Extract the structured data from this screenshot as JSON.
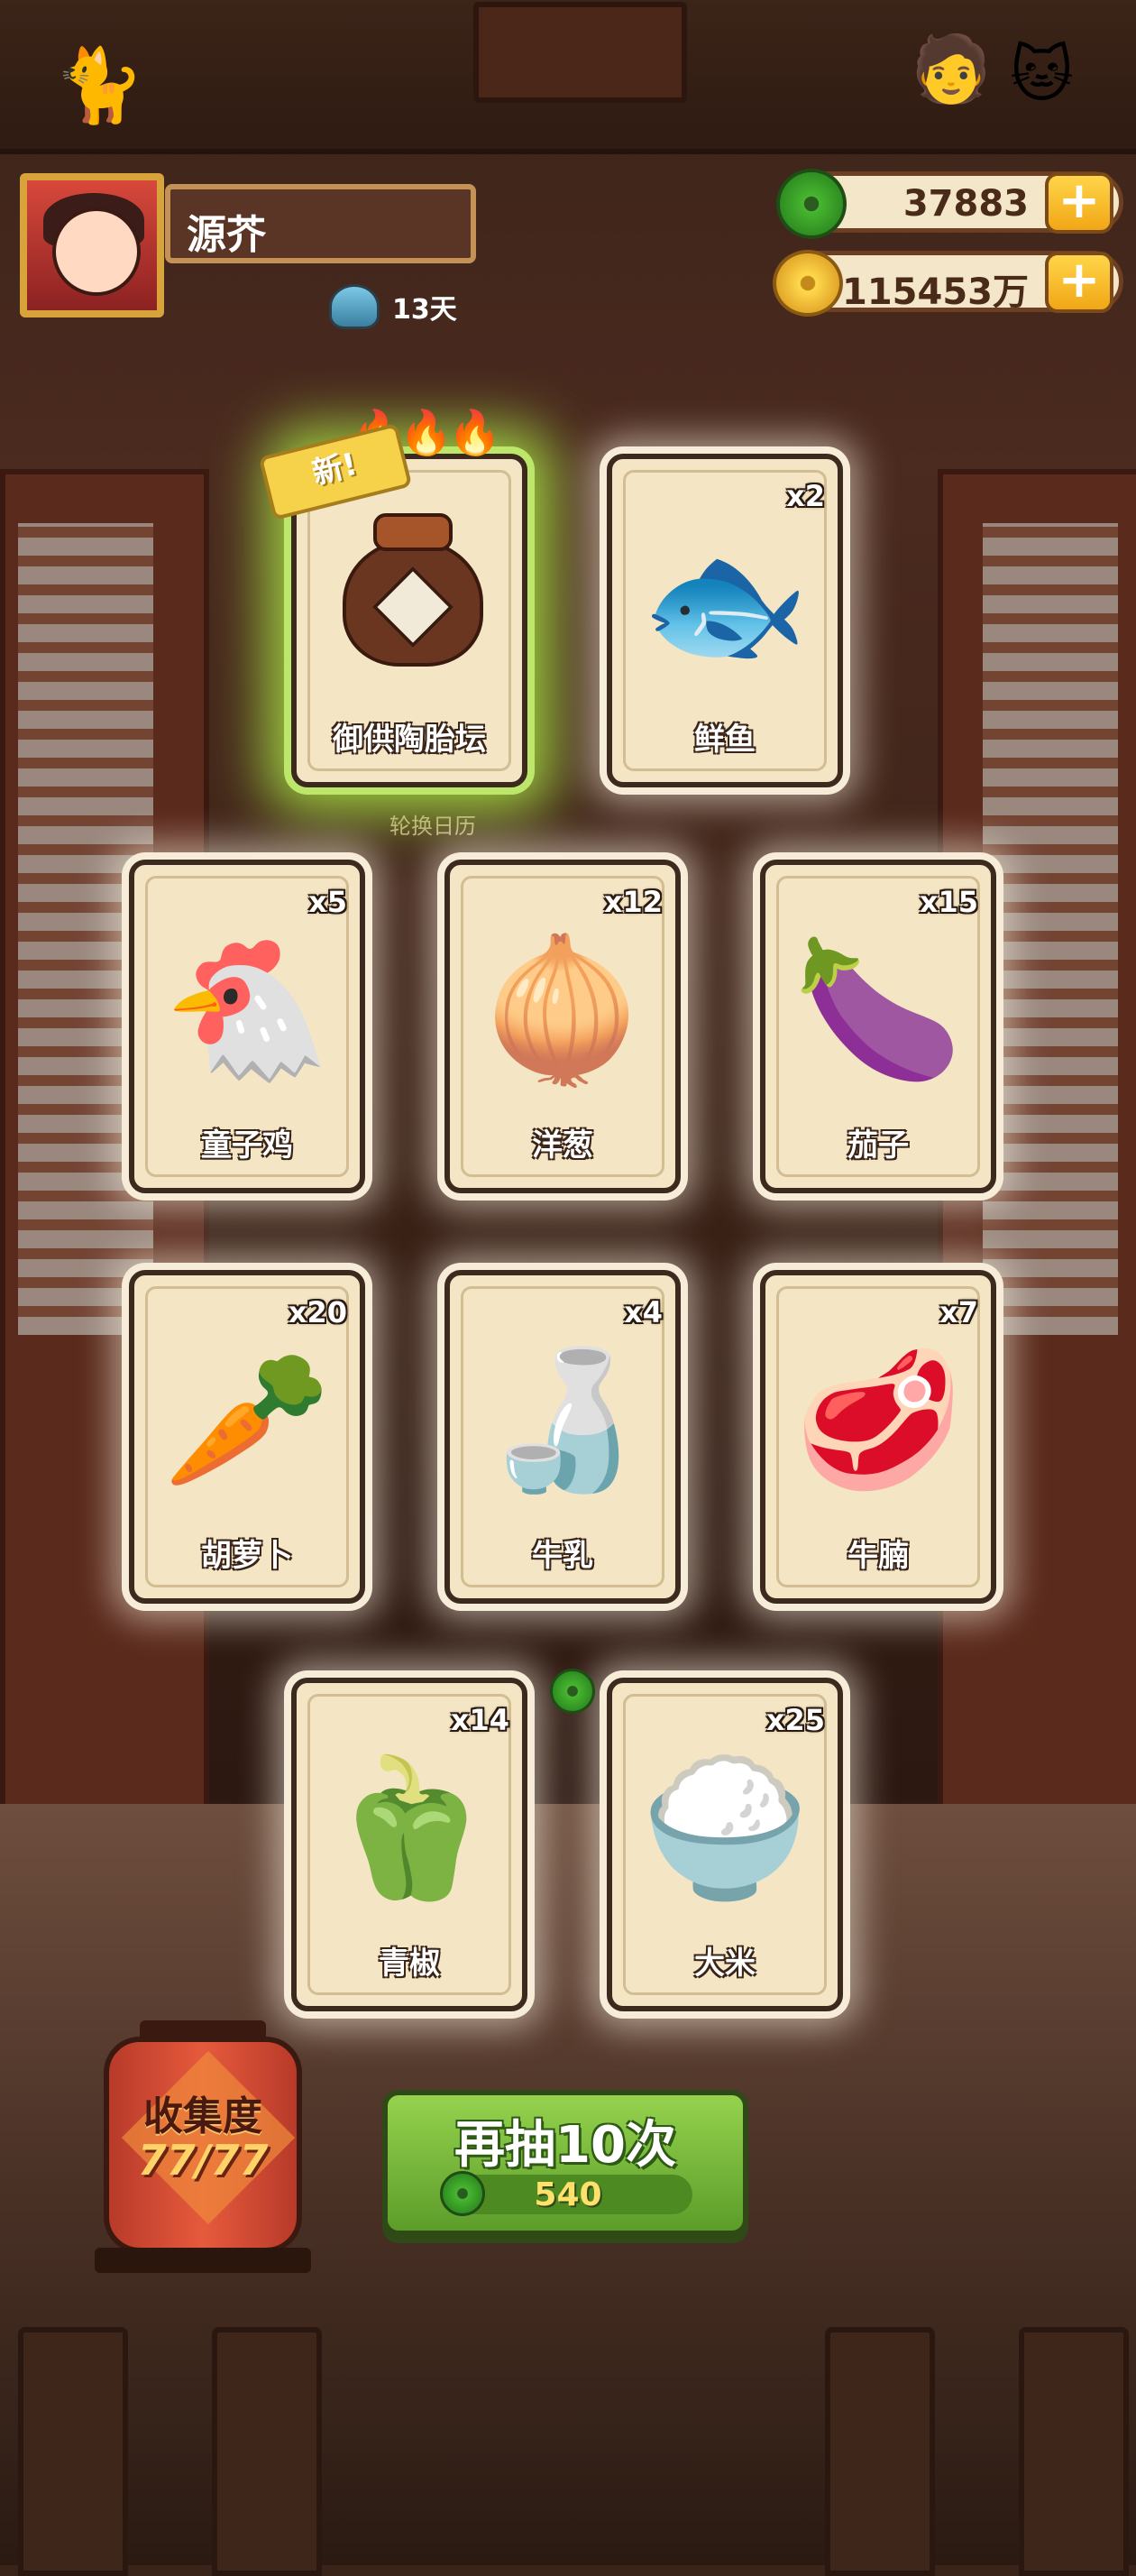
{
  "player": {
    "name": "源芥",
    "days": "13天"
  },
  "currencies": {
    "jade": "37883",
    "coins": "115453万"
  },
  "calendar_label": "轮换日历",
  "cards": [
    {
      "name": "御供陶胎坛",
      "count": "",
      "new_badge": "新!",
      "featured": true,
      "icon": "clay-jar-icon"
    },
    {
      "name": "鲜鱼",
      "count": "x2",
      "icon": "fish-icon",
      "art": "🐟"
    },
    {
      "name": "童子鸡",
      "count": "x5",
      "icon": "chicken-icon",
      "art": "🐔"
    },
    {
      "name": "洋葱",
      "count": "x12",
      "icon": "onion-icon",
      "art": "🧅"
    },
    {
      "name": "茄子",
      "count": "x15",
      "icon": "eggplant-icon",
      "art": "🍆"
    },
    {
      "name": "胡萝卜",
      "count": "x20",
      "icon": "carrot-icon",
      "art": "🥕"
    },
    {
      "name": "牛乳",
      "count": "x4",
      "icon": "milk-jar-icon",
      "art": "🍶"
    },
    {
      "name": "牛腩",
      "count": "x7",
      "icon": "beef-icon",
      "art": "🥩"
    },
    {
      "name": "青椒",
      "count": "x14",
      "icon": "green-pepper-icon",
      "art": "🫑"
    },
    {
      "name": "大米",
      "count": "x25",
      "icon": "rice-bowl-icon",
      "art": "🍚"
    }
  ],
  "collection": {
    "title": "收集度",
    "value": "77/77"
  },
  "draw_button": {
    "label": "再抽10次",
    "cost": "540"
  },
  "colors": {
    "accent_green": "#5c9d2a",
    "card_bg": "#f4e5c4",
    "glow": "#bde76a",
    "lantern_red": "#d84a32"
  }
}
